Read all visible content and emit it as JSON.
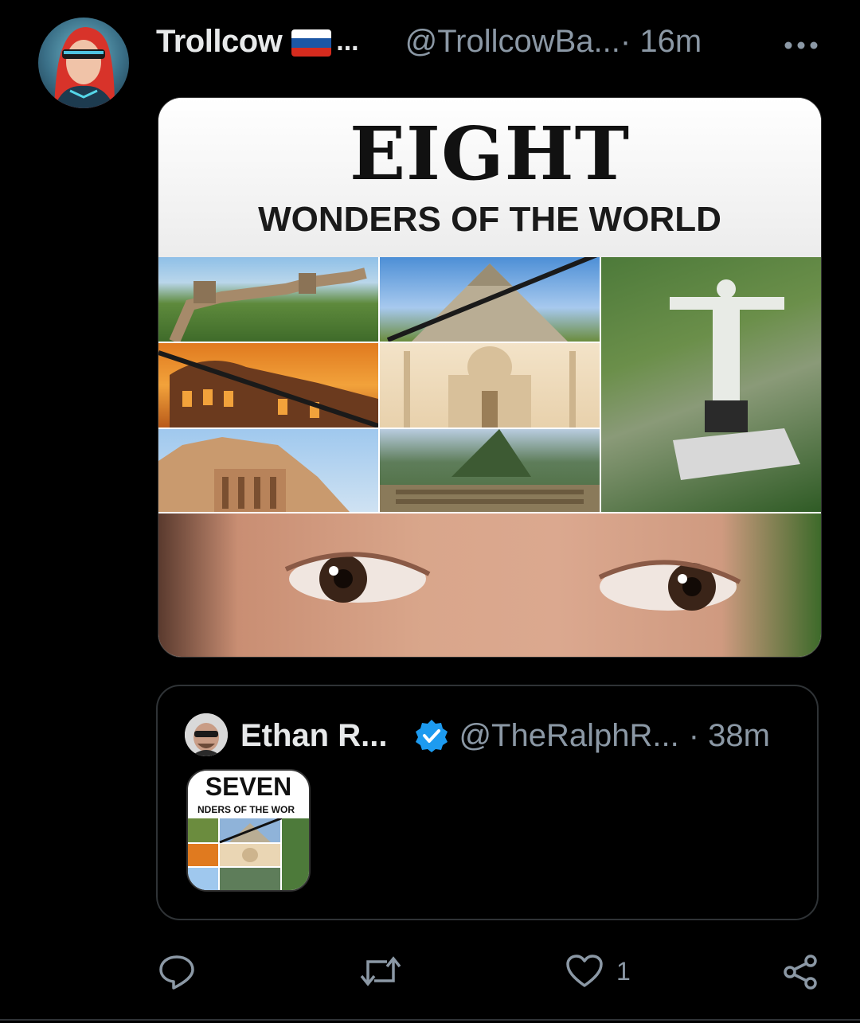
{
  "post": {
    "author_name": "Trollcow",
    "name_ellipsis": "...",
    "handle": "@TrollcowBa...",
    "time": " · 16m",
    "more_icon": "more-horizontal-icon",
    "media": {
      "title": "EIGHT",
      "subtitle": "WONDERS OF THE WORLD"
    }
  },
  "quoted": {
    "author_name": "Ethan R...",
    "verified_icon": "verified-badge-icon",
    "handle": "@TheRalphR...",
    "time": "· 38m",
    "thumb_title": "SEVEN",
    "thumb_subtitle": "NDERS OF THE WOR"
  },
  "actions": {
    "reply_icon": "reply-icon",
    "repost_icon": "repost-icon",
    "like_icon": "heart-icon",
    "like_count": "1",
    "share_icon": "share-icon"
  },
  "colors": {
    "background": "#000000",
    "text_primary": "#e7e9ea",
    "text_secondary": "#8b98a5",
    "verified_blue": "#1d9bf0",
    "border": "#2f3336"
  }
}
